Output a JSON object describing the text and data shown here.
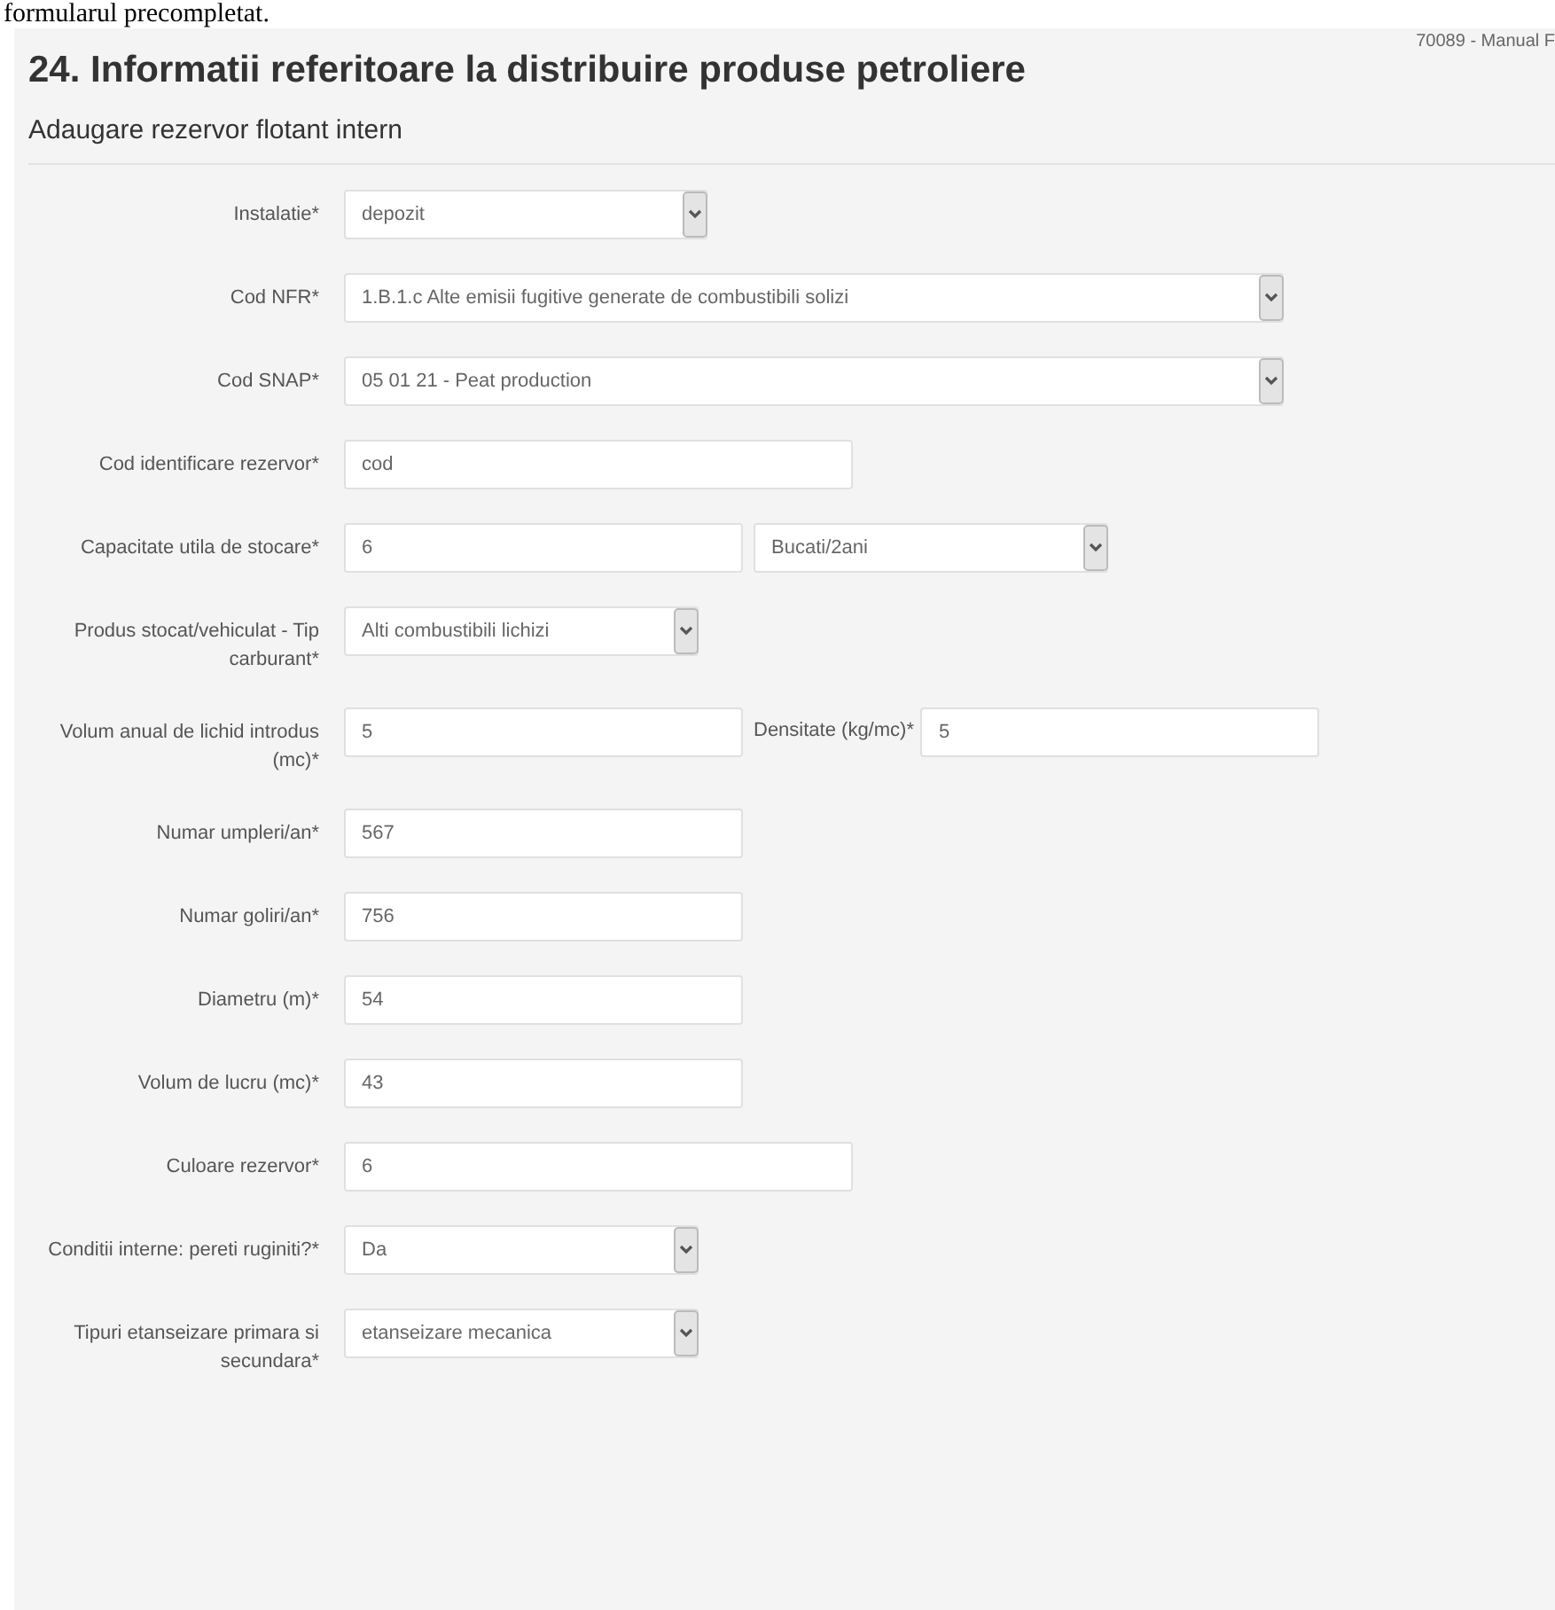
{
  "document_text": "formularul precompletat.",
  "page_ref": "70089 - Manual F",
  "title": "24. Informatii referitoare la distribuire produse petroliere",
  "subtitle": "Adaugare rezervor flotant intern",
  "rows": [
    {
      "label": "Instalatie*",
      "controls": [
        {
          "kind": "select",
          "value": "depozit"
        }
      ]
    },
    {
      "label": "Cod NFR*",
      "controls": [
        {
          "kind": "select",
          "value": "1.B.1.c Alte emisii fugitive generate de combustibili solizi"
        }
      ]
    },
    {
      "label": "Cod SNAP*",
      "controls": [
        {
          "kind": "select",
          "value": "05 01 21 - Peat production"
        }
      ]
    },
    {
      "label": "Cod identificare rezervor*",
      "controls": [
        {
          "kind": "input",
          "value": "cod"
        }
      ]
    },
    {
      "label": "Capacitate utila de stocare*",
      "controls": [
        {
          "kind": "input",
          "value": "6"
        },
        {
          "kind": "select",
          "value": "Bucati/2ani"
        }
      ]
    },
    {
      "label": "Produs stocat/vehiculat - Tip carburant*",
      "controls": [
        {
          "kind": "select",
          "value": "Alti combustibili lichizi"
        }
      ]
    },
    {
      "label": "Volum anual de lichid introdus (mc)*",
      "controls": [
        {
          "kind": "input",
          "value": "5"
        },
        {
          "kind": "label",
          "value": "Densitate (kg/mc)*"
        },
        {
          "kind": "input",
          "value": "5"
        }
      ]
    },
    {
      "label": "Numar umpleri/an*",
      "controls": [
        {
          "kind": "input",
          "value": "567"
        }
      ]
    },
    {
      "label": "Numar goliri/an*",
      "controls": [
        {
          "kind": "input",
          "value": "756"
        }
      ]
    },
    {
      "label": "Diametru (m)*",
      "controls": [
        {
          "kind": "input",
          "value": "54"
        }
      ]
    },
    {
      "label": "Volum de lucru (mc)*",
      "controls": [
        {
          "kind": "input",
          "value": "43"
        }
      ]
    },
    {
      "label": "Culoare rezervor*",
      "controls": [
        {
          "kind": "input",
          "value": "6"
        }
      ]
    },
    {
      "label": "Conditii interne: pereti ruginiti?*",
      "controls": [
        {
          "kind": "select",
          "value": "Da"
        }
      ]
    },
    {
      "label": "Tipuri etanseizare primara si secundara*",
      "controls": [
        {
          "kind": "select",
          "value": "etanseizare mecanica"
        }
      ]
    }
  ]
}
